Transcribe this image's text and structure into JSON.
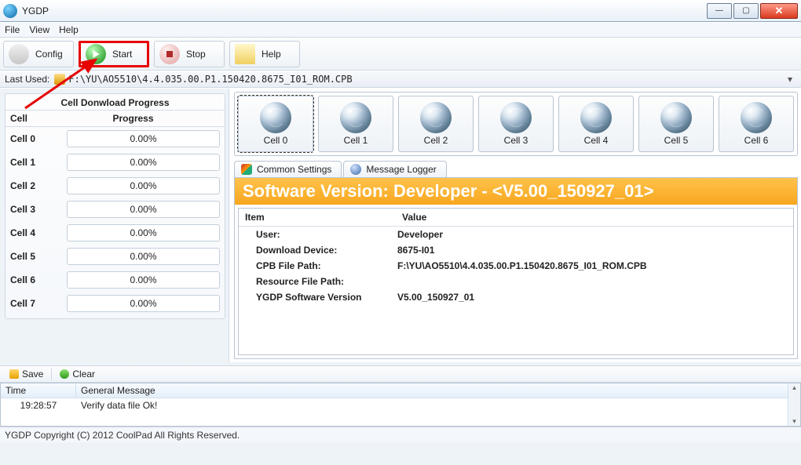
{
  "window": {
    "title": "YGDP"
  },
  "menu": {
    "file": "File",
    "view": "View",
    "help": "Help"
  },
  "toolbar": {
    "config": "Config",
    "start": "Start",
    "stop": "Stop",
    "help": "Help"
  },
  "last_used": {
    "label": "Last Used:",
    "path": "F:\\YU\\AO5510\\4.4.035.00.P1.150420.8675_I01_ROM.CPB"
  },
  "cell_progress": {
    "title": "Cell Donwload Progress",
    "head_cell": "Cell",
    "head_progress": "Progress",
    "rows": [
      {
        "name": "Cell 0",
        "pct": "0.00%"
      },
      {
        "name": "Cell 1",
        "pct": "0.00%"
      },
      {
        "name": "Cell 2",
        "pct": "0.00%"
      },
      {
        "name": "Cell 3",
        "pct": "0.00%"
      },
      {
        "name": "Cell 4",
        "pct": "0.00%"
      },
      {
        "name": "Cell 5",
        "pct": "0.00%"
      },
      {
        "name": "Cell 6",
        "pct": "0.00%"
      },
      {
        "name": "Cell 7",
        "pct": "0.00%"
      }
    ]
  },
  "cells_row": {
    "items": [
      {
        "label": "Cell 0",
        "selected": true
      },
      {
        "label": "Cell 1",
        "selected": false
      },
      {
        "label": "Cell 2",
        "selected": false
      },
      {
        "label": "Cell 3",
        "selected": false
      },
      {
        "label": "Cell 4",
        "selected": false
      },
      {
        "label": "Cell 5",
        "selected": false
      },
      {
        "label": "Cell 6",
        "selected": false
      }
    ]
  },
  "tabs": {
    "common": "Common Settings",
    "logger": "Message Logger"
  },
  "version_banner": "Software Version:  Developer - <V5.00_150927_01>",
  "info": {
    "head_item": "Item",
    "head_value": "Value",
    "rows": [
      {
        "k": "User:",
        "v": "Developer"
      },
      {
        "k": "Download Device:",
        "v": "8675-I01"
      },
      {
        "k": "CPB File Path:",
        "v": "F:\\YU\\AO5510\\4.4.035.00.P1.150420.8675_I01_ROM.CPB"
      },
      {
        "k": "Resource File Path:",
        "v": ""
      },
      {
        "k": "YGDP Software Version",
        "v": "V5.00_150927_01"
      }
    ]
  },
  "log_tools": {
    "save": "Save",
    "clear": "Clear"
  },
  "log": {
    "head_time": "Time",
    "head_msg": "General Message",
    "rows": [
      {
        "time": "19:28:57",
        "msg": "Verify data file Ok!"
      }
    ]
  },
  "status": "YGDP Copyright (C) 2012 CoolPad All Rights Reserved."
}
